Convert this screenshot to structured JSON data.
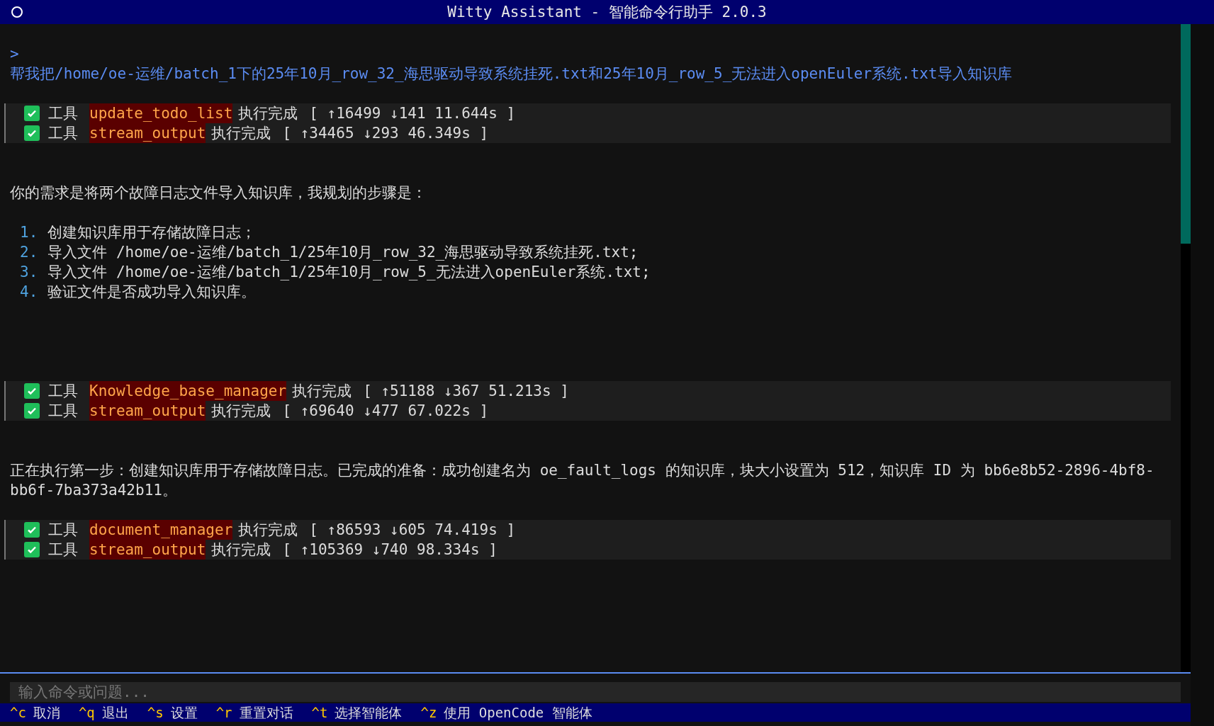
{
  "window": {
    "title": "Witty Assistant - 智能命令行助手 2.0.3"
  },
  "messages": [
    {
      "kind": "user",
      "prompt": ">",
      "text": "帮我把/home/oe-运维/batch_1下的25年10月_row_32_海思驱动导致系统挂死.txt和25年10月_row_5_无法进入openEuler系统.txt导入知识库"
    },
    {
      "kind": "tools",
      "tools": [
        {
          "label": "工具",
          "name": "update_todo_list",
          "status": "执行完成",
          "stats": "[ ↑16499 ↓141 11.644s ]",
          "done": true
        },
        {
          "label": "工具",
          "name": "stream_output",
          "status": "执行完成",
          "stats": "[ ↑34465 ↓293 46.349s ]",
          "done": true
        }
      ]
    },
    {
      "kind": "text",
      "text": "你的需求是将两个故障日志文件导入知识库，我规划的步骤是："
    },
    {
      "kind": "list",
      "items": [
        {
          "number": "1.",
          "text": "创建知识库用于存储故障日志；"
        },
        {
          "number": "2.",
          "text": "导入文件 /home/oe-运维/batch_1/25年10月_row_32_海思驱动导致系统挂死.txt;"
        },
        {
          "number": "3.",
          "text": "导入文件 /home/oe-运维/batch_1/25年10月_row_5_无法进入openEuler系统.txt;"
        },
        {
          "number": "4.",
          "text": "验证文件是否成功导入知识库。"
        }
      ]
    },
    {
      "kind": "tools",
      "tools": [
        {
          "label": "工具",
          "name": "Knowledge_base_manager",
          "status": "执行完成",
          "stats": "[ ↑51188 ↓367 51.213s ]",
          "done": true
        },
        {
          "label": "工具",
          "name": "stream_output",
          "status": "执行完成",
          "stats": "[ ↑69640 ↓477 67.022s ]",
          "done": true
        }
      ]
    },
    {
      "kind": "text",
      "text": "正在执行第一步：创建知识库用于存储故障日志。已完成的准备：成功创建名为 oe_fault_logs 的知识库，块大小设置为 512，知识库 ID 为 bb6e8b52-2896-4bf8-bb6f-7ba373a42b11。"
    },
    {
      "kind": "tools",
      "tools": [
        {
          "label": "工具",
          "name": "document_manager",
          "status": "执行完成",
          "stats": "[ ↑86593 ↓605 74.419s ]",
          "done": true
        },
        {
          "label": "工具",
          "name": "stream_output",
          "status": "执行完成",
          "stats": "[ ↑105369 ↓740 98.334s ]",
          "done": true
        }
      ]
    }
  ],
  "input": {
    "placeholder": "输入命令或问题..."
  },
  "shortcuts": [
    {
      "key": "^c",
      "label": "取消"
    },
    {
      "key": "^q",
      "label": "退出"
    },
    {
      "key": "^s",
      "label": "设置"
    },
    {
      "key": "^r",
      "label": "重置对话"
    },
    {
      "key": "^t",
      "label": "选择智能体"
    },
    {
      "key": "^z",
      "label": "使用 OpenCode 智能体"
    }
  ]
}
